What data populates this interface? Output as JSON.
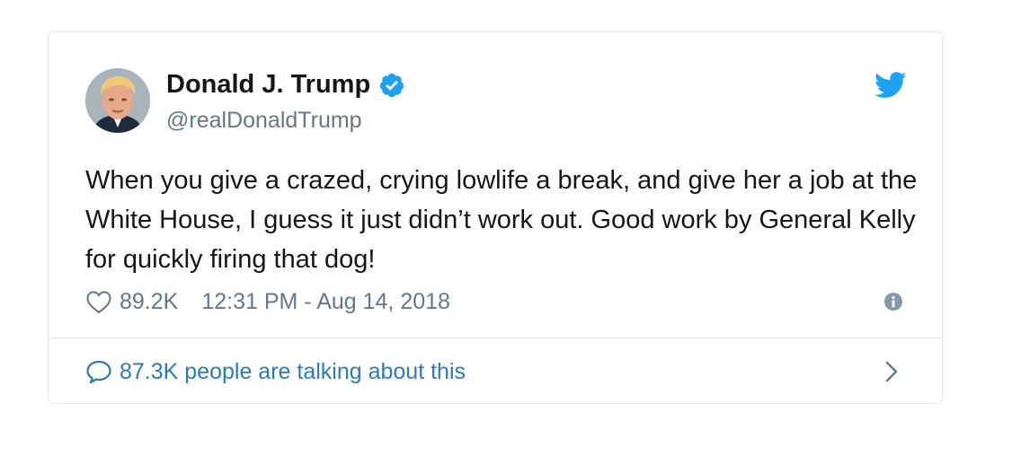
{
  "tweet": {
    "author": {
      "display_name": "Donald J. Trump",
      "handle": "@realDonaldTrump",
      "verified": true
    },
    "text": "When you give a crazed, crying lowlife a break, and give her a job at the White House, I guess it just didn’t work out. Good work by General Kelly for quickly firing that dog!",
    "likes": "89.2K",
    "timestamp": "12:31 PM - Aug 14, 2018",
    "conversation": "87.3K people are talking about this"
  },
  "icons": {
    "brand": "twitter-bird-icon",
    "verified": "verified-badge-icon",
    "like": "heart-icon",
    "info": "info-icon",
    "reply": "speech-bubble-icon",
    "more": "chevron-right-icon"
  },
  "colors": {
    "twitter_blue": "#1da1f2",
    "link_blue": "#2b7bb9",
    "text": "#14171a",
    "muted": "#657786",
    "border": "#e1e8ed"
  }
}
